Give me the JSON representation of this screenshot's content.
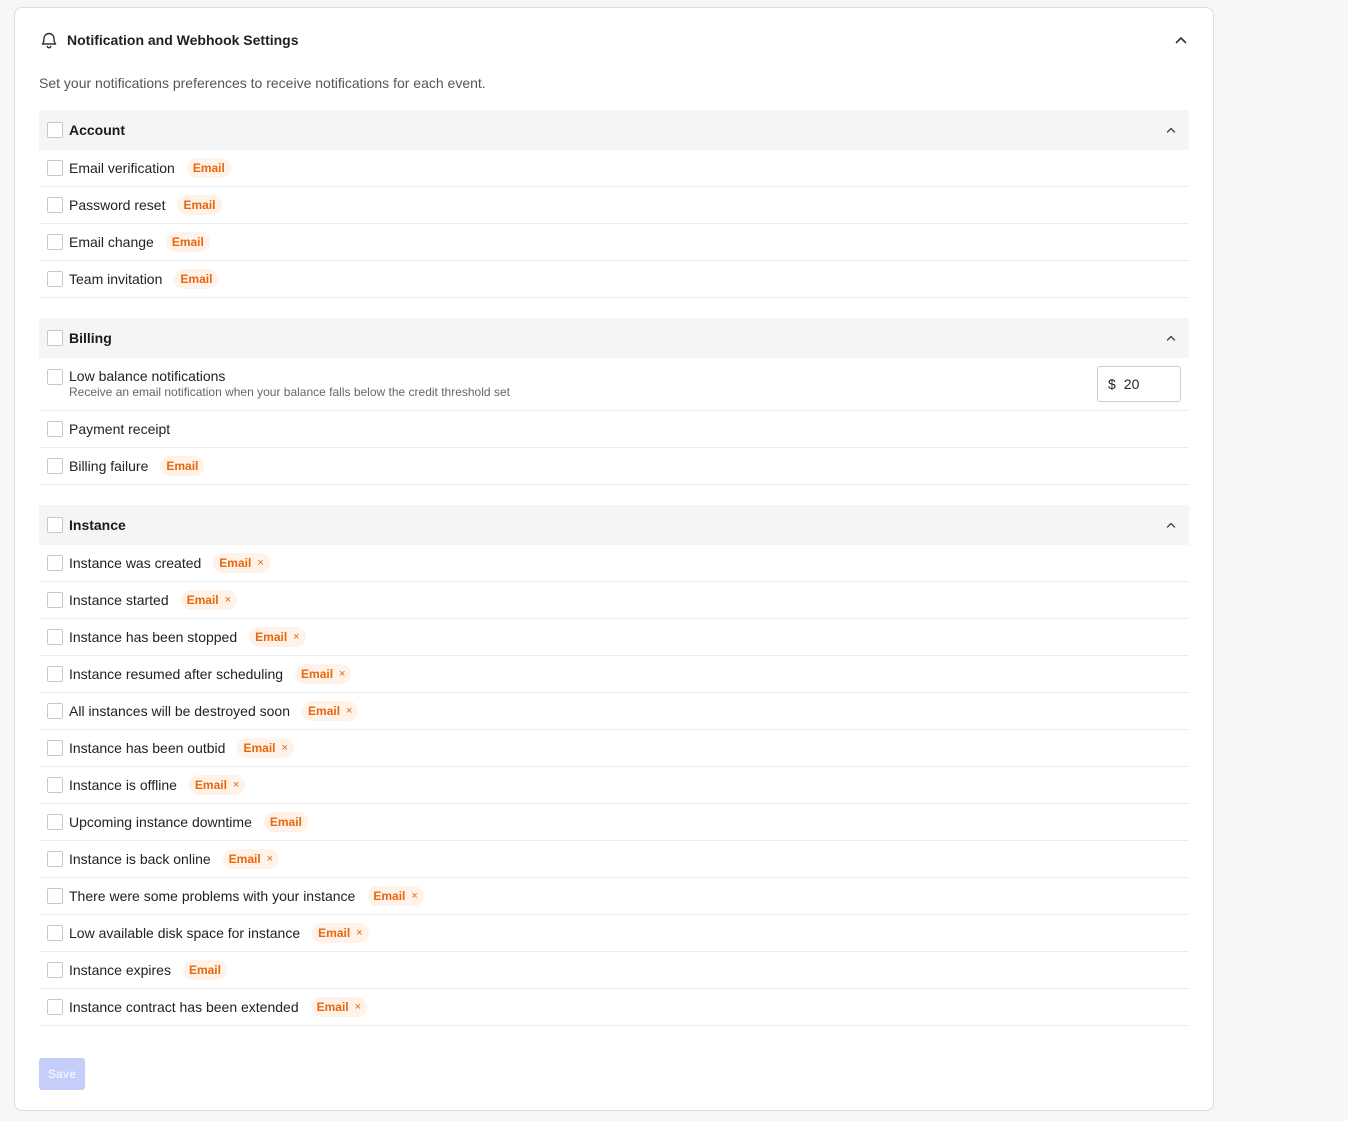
{
  "header": {
    "title": "Notification and Webhook Settings",
    "description": "Set your notifications preferences to receive notifications for each event."
  },
  "colors": {
    "badge_text": "#e8660c",
    "badge_bg": "#fff2e8",
    "save_button_bg": "#c5cdfb"
  },
  "icons": {
    "header": "bell-icon",
    "collapse": "chevron-up-icon",
    "badge_remove": "close-icon"
  },
  "account": {
    "title": "Account",
    "items": [
      {
        "label": "Email verification",
        "badge": "Email"
      },
      {
        "label": "Password reset",
        "badge": "Email"
      },
      {
        "label": "Email change",
        "badge": "Email"
      },
      {
        "label": "Team invitation",
        "badge": "Email"
      }
    ]
  },
  "billing": {
    "title": "Billing",
    "low_balance": {
      "label": "Low balance notifications",
      "description": "Receive an email notification when your balance falls below the credit threshold set",
      "currency": "$",
      "threshold": "20"
    },
    "items": [
      {
        "label": "Payment receipt"
      },
      {
        "label": "Billing failure",
        "badge": "Email"
      }
    ]
  },
  "instance": {
    "title": "Instance",
    "items": [
      {
        "label": "Instance was created",
        "badge": "Email",
        "removable": true
      },
      {
        "label": "Instance started",
        "badge": "Email",
        "removable": true
      },
      {
        "label": "Instance has been stopped",
        "badge": "Email",
        "removable": true
      },
      {
        "label": "Instance resumed after scheduling",
        "badge": "Email",
        "removable": true
      },
      {
        "label": "All instances will be destroyed soon",
        "badge": "Email",
        "removable": true
      },
      {
        "label": "Instance has been outbid",
        "badge": "Email",
        "removable": true
      },
      {
        "label": "Instance is offline",
        "badge": "Email",
        "removable": true
      },
      {
        "label": "Upcoming instance downtime",
        "badge": "Email",
        "removable": false
      },
      {
        "label": "Instance is back online",
        "badge": "Email",
        "removable": true
      },
      {
        "label": "There were some problems with your instance",
        "badge": "Email",
        "removable": true
      },
      {
        "label": "Low available disk space for instance",
        "badge": "Email",
        "removable": true
      },
      {
        "label": "Instance expires",
        "badge": "Email",
        "removable": false
      },
      {
        "label": "Instance contract has been extended",
        "badge": "Email",
        "removable": true
      }
    ]
  },
  "remove_glyph": "×",
  "save_label": "Save"
}
